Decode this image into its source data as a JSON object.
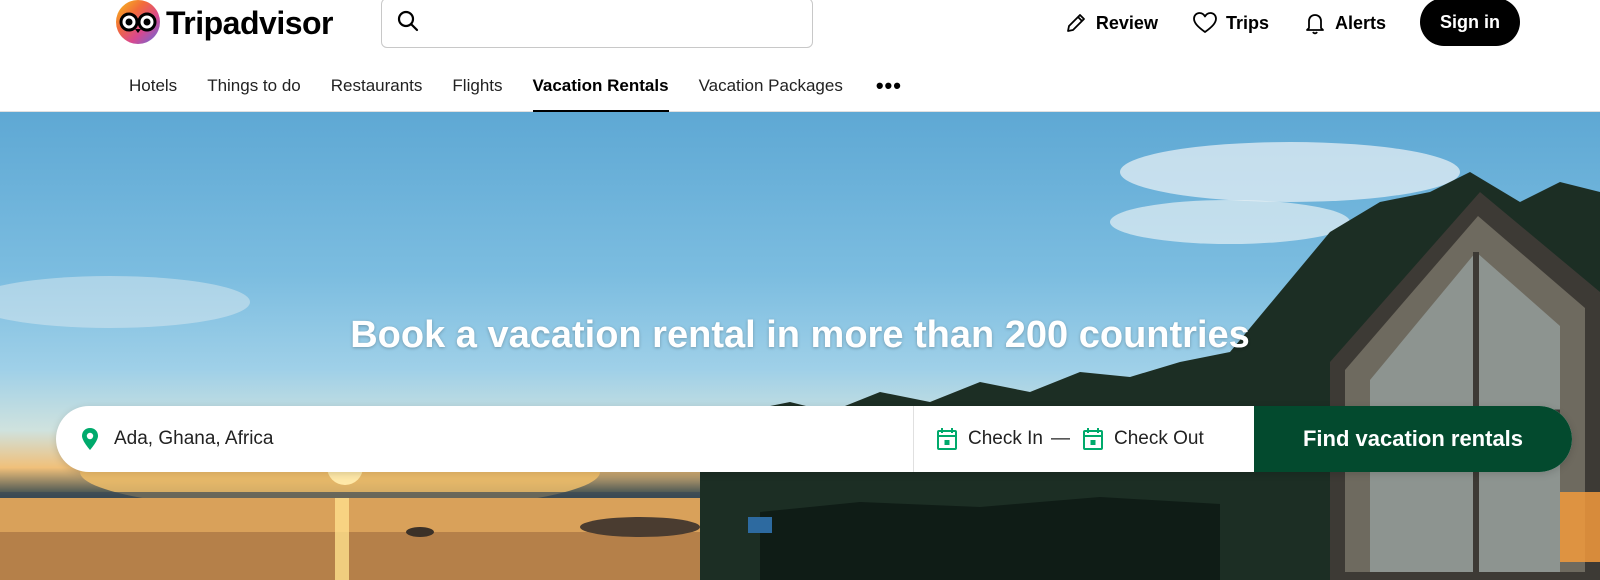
{
  "brand": {
    "name": "Tripadvisor"
  },
  "search": {
    "placeholder": ""
  },
  "header_nav": {
    "review_label": "Review",
    "trips_label": "Trips",
    "alerts_label": "Alerts",
    "signin_label": "Sign in"
  },
  "tabs": [
    {
      "label": "Hotels",
      "active": false
    },
    {
      "label": "Things to do",
      "active": false
    },
    {
      "label": "Restaurants",
      "active": false
    },
    {
      "label": "Flights",
      "active": false
    },
    {
      "label": "Vacation Rentals",
      "active": true
    },
    {
      "label": "Vacation Packages",
      "active": false
    }
  ],
  "tabs_more": "•••",
  "hero": {
    "title": "Book a vacation rental in more than 200 countries",
    "location_value": "Ada, Ghana, Africa",
    "check_in_label": "Check In",
    "dash": "—",
    "check_out_label": "Check Out",
    "find_button_label": "Find vacation rentals"
  },
  "colors": {
    "brand_green": "#034a2e",
    "accent_green": "#00aa6c",
    "signin_bg": "#000000"
  },
  "icons": [
    "search-icon",
    "pencil-icon",
    "heart-icon",
    "bell-icon",
    "map-pin-icon",
    "calendar-icon",
    "more-icon"
  ]
}
